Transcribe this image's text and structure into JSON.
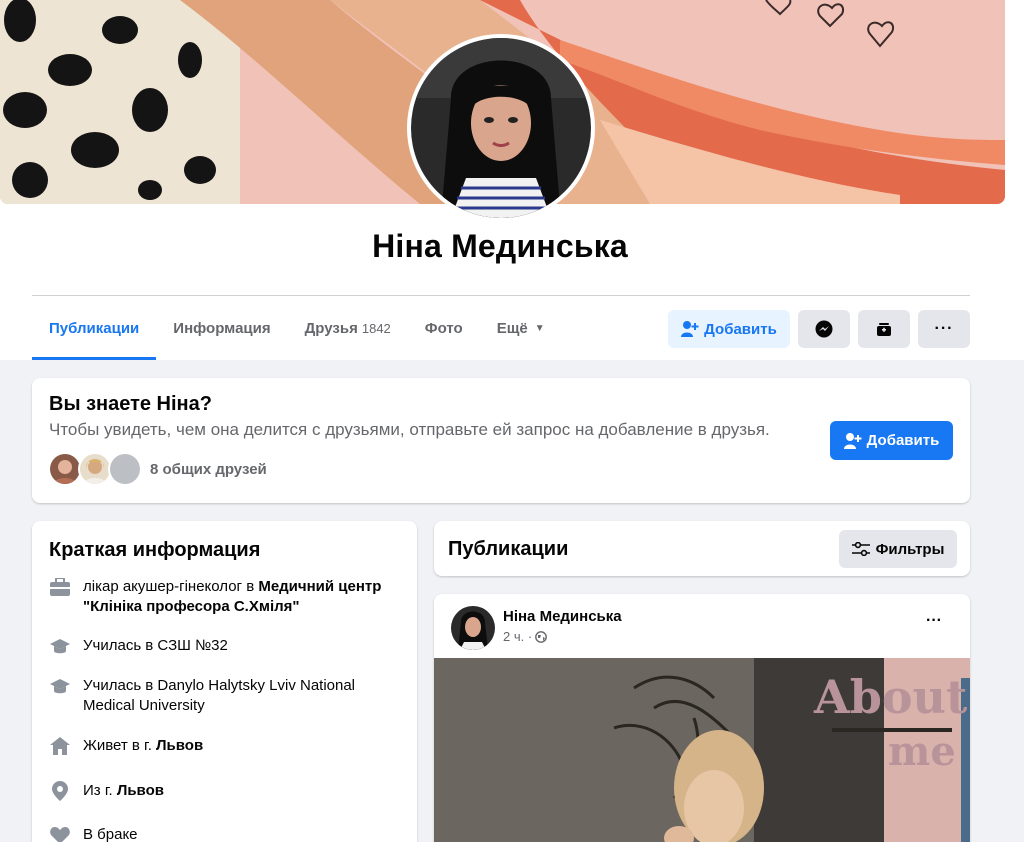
{
  "profile": {
    "name": "Ніна Мединська"
  },
  "tabs": [
    {
      "label": "Публикации"
    },
    {
      "label": "Информация"
    },
    {
      "label": "Друзья",
      "count": "1842"
    },
    {
      "label": "Фото"
    },
    {
      "label": "Ещё"
    }
  ],
  "actions": {
    "add_friend_label": "Добавить",
    "more_label": "···"
  },
  "know_card": {
    "title": "Вы знаете Ніна?",
    "subtitle": "Чтобы увидеть, чем она делится с друзьями, отправьте ей запрос на добавление в друзья.",
    "mutual_friends": "8 общих друзей",
    "add_label": "Добавить"
  },
  "intro": {
    "title": "Краткая информация",
    "work_prefix": "лікар акушер-гінеколог в ",
    "work_place": "Медичний центр \"Клініка професора С.Хміля\"",
    "school": "Училась в СЗШ №32",
    "university": "Училась в Danylo Halytsky Lviv National Medical University",
    "lives_prefix": "Живет в г. ",
    "lives_city": "Львов",
    "from_prefix": "Из г. ",
    "from_city": "Львов",
    "relationship": "В браке"
  },
  "posts": {
    "title": "Публикации",
    "filters_label": "Фильтры",
    "post": {
      "author": "Ніна Мединська",
      "time": "2 ч. ·",
      "more_label": "···",
      "image_text_1": "About",
      "image_text_2": "me"
    }
  },
  "colors": {
    "accent": "#1877f2",
    "accent_light": "#e7f3ff",
    "secondary_text": "#65676b",
    "background": "#f0f2f5"
  }
}
